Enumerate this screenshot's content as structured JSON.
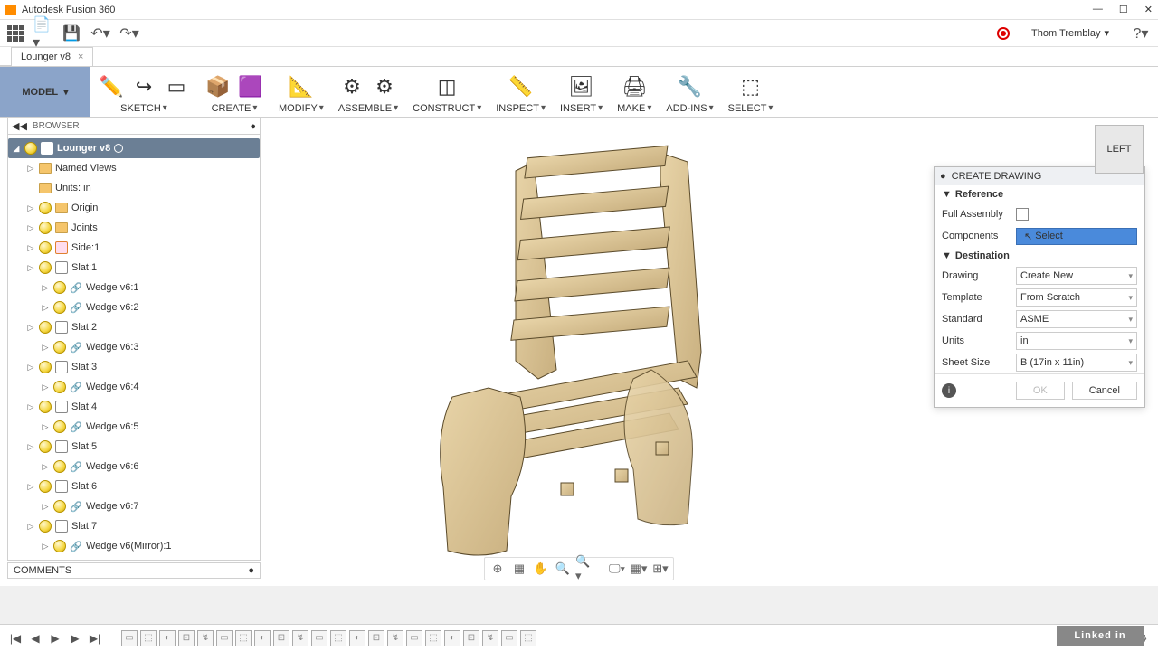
{
  "window": {
    "title": "Autodesk Fusion 360",
    "user": "Thom Tremblay"
  },
  "document": {
    "tab": "Lounger v8"
  },
  "workspace": {
    "label": "MODEL"
  },
  "ribbon": {
    "sketch": "SKETCH",
    "create": "CREATE",
    "modify": "MODIFY",
    "assemble": "ASSEMBLE",
    "construct": "CONSTRUCT",
    "inspect": "INSPECT",
    "insert": "INSERT",
    "make": "MAKE",
    "addins": "ADD-INS",
    "select": "SELECT"
  },
  "browser": {
    "title": "BROWSER",
    "root": "Lounger v8",
    "items": [
      {
        "label": "Named Views",
        "icon": "folder",
        "indent": 1,
        "tri": true
      },
      {
        "label": "Units: in",
        "icon": "folder",
        "indent": 1,
        "tri": false
      },
      {
        "label": "Origin",
        "icon": "folder",
        "indent": 1,
        "tri": true,
        "bulb": true
      },
      {
        "label": "Joints",
        "icon": "folder",
        "indent": 1,
        "tri": true,
        "bulb": true
      },
      {
        "label": "Side:1",
        "icon": "box",
        "indent": 1,
        "tri": true,
        "bulb": true,
        "boxOrange": true
      },
      {
        "label": "Slat:1",
        "icon": "box",
        "indent": 1,
        "tri": true,
        "bulb": true
      },
      {
        "label": "Wedge v6:1",
        "icon": "link",
        "indent": 2,
        "tri": true,
        "bulb": true
      },
      {
        "label": "Wedge v6:2",
        "icon": "link",
        "indent": 2,
        "tri": true,
        "bulb": true
      },
      {
        "label": "Slat:2",
        "icon": "box",
        "indent": 1,
        "tri": true,
        "bulb": true
      },
      {
        "label": "Wedge v6:3",
        "icon": "link",
        "indent": 2,
        "tri": true,
        "bulb": true
      },
      {
        "label": "Slat:3",
        "icon": "box",
        "indent": 1,
        "tri": true,
        "bulb": true
      },
      {
        "label": "Wedge v6:4",
        "icon": "link",
        "indent": 2,
        "tri": true,
        "bulb": true
      },
      {
        "label": "Slat:4",
        "icon": "box",
        "indent": 1,
        "tri": true,
        "bulb": true
      },
      {
        "label": "Wedge v6:5",
        "icon": "link",
        "indent": 2,
        "tri": true,
        "bulb": true
      },
      {
        "label": "Slat:5",
        "icon": "box",
        "indent": 1,
        "tri": true,
        "bulb": true
      },
      {
        "label": "Wedge v6:6",
        "icon": "link",
        "indent": 2,
        "tri": true,
        "bulb": true
      },
      {
        "label": "Slat:6",
        "icon": "box",
        "indent": 1,
        "tri": true,
        "bulb": true
      },
      {
        "label": "Wedge v6:7",
        "icon": "link",
        "indent": 2,
        "tri": true,
        "bulb": true
      },
      {
        "label": "Slat:7",
        "icon": "box",
        "indent": 1,
        "tri": true,
        "bulb": true
      },
      {
        "label": "Wedge v6(Mirror):1",
        "icon": "link",
        "indent": 2,
        "tri": true,
        "bulb": true
      }
    ]
  },
  "dialog": {
    "title": "CREATE DRAWING",
    "sec_reference": "Reference",
    "full_assembly": "Full Assembly",
    "components": "Components",
    "select_btn": "Select",
    "sec_destination": "Destination",
    "drawing_lbl": "Drawing",
    "drawing_val": "Create New",
    "template_lbl": "Template",
    "template_val": "From Scratch",
    "standard_lbl": "Standard",
    "standard_val": "ASME",
    "units_lbl": "Units",
    "units_val": "in",
    "sheet_lbl": "Sheet Size",
    "sheet_val": "B (17in x 11in)",
    "ok": "OK",
    "cancel": "Cancel"
  },
  "viewcube": {
    "face": "LEFT"
  },
  "comments": {
    "label": "COMMENTS"
  },
  "watermark": "Linked in"
}
